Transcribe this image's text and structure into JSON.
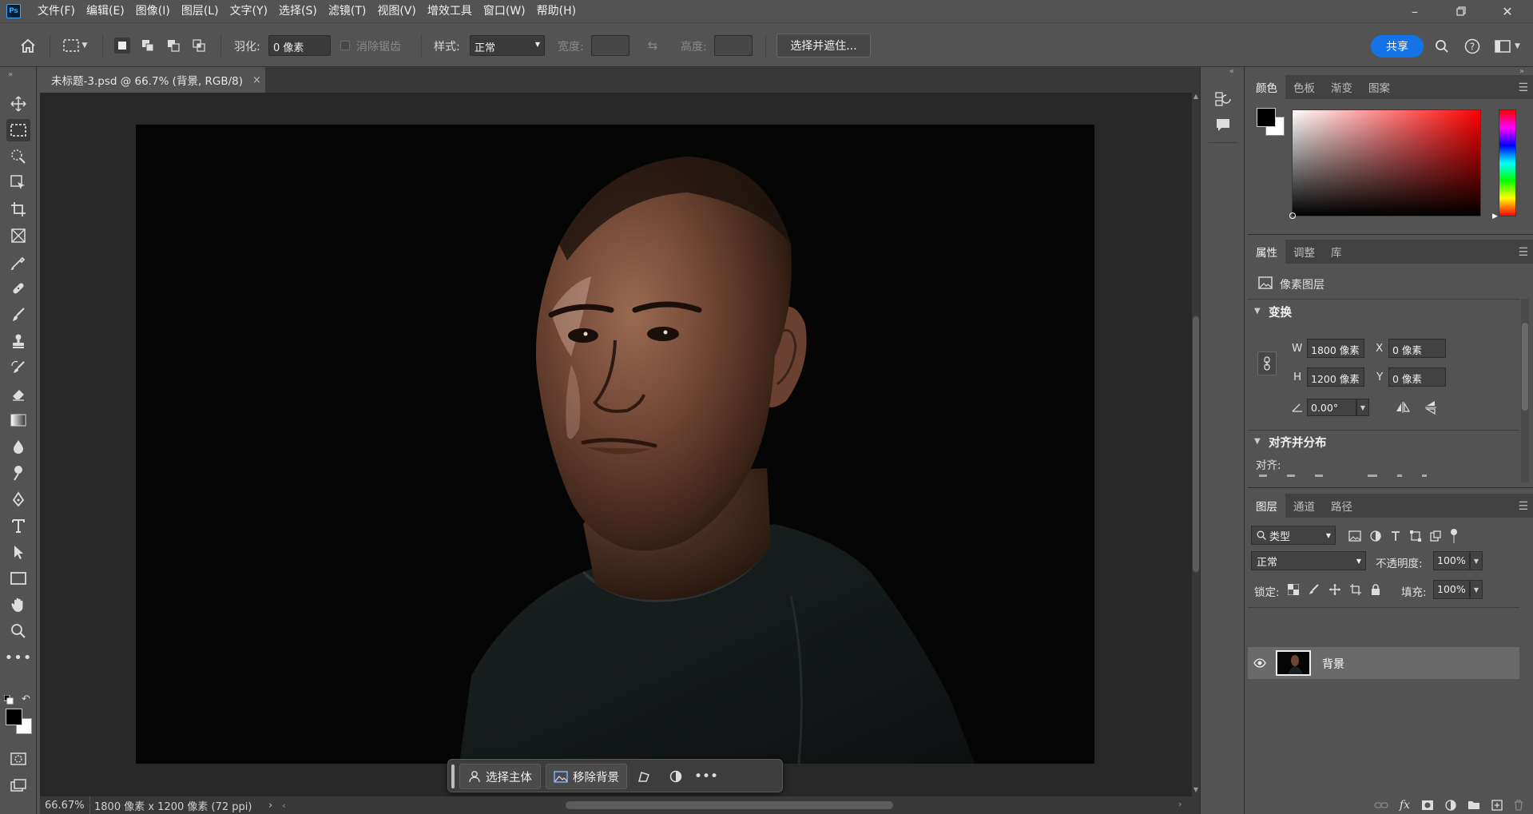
{
  "menubar": {
    "logo": "Ps",
    "items": [
      "文件(F)",
      "编辑(E)",
      "图像(I)",
      "图层(L)",
      "文字(Y)",
      "选择(S)",
      "滤镜(T)",
      "视图(V)",
      "增效工具",
      "窗口(W)",
      "帮助(H)"
    ]
  },
  "options": {
    "feather_label": "羽化:",
    "feather_value": "0 像素",
    "antialias_label": "消除锯齿",
    "style_label": "样式:",
    "style_value": "正常",
    "width_label": "宽度:",
    "height_label": "高度:",
    "select_mask_button": "选择并遮住...",
    "share_button": "共享"
  },
  "document": {
    "tab_title": "未标题-3.psd @ 66.7% (背景, RGB/8)",
    "close_glyph": "×"
  },
  "status": {
    "zoom": "66.67%",
    "doc_info": "1800 像素 x 1200 像素 (72 ppi)"
  },
  "contextual_taskbar": {
    "select_subject": "选择主体",
    "remove_background": "移除背景"
  },
  "color_panel": {
    "tabs": [
      "颜色",
      "色板",
      "渐变",
      "图案"
    ],
    "foreground": "#000000",
    "background": "#ffffff",
    "hue": "#ff0000"
  },
  "properties_panel": {
    "tabs": [
      "属性",
      "调整",
      "库"
    ],
    "layer_type": "像素图层",
    "transform_title": "变换",
    "w_label": "W",
    "w_value": "1800 像素",
    "h_label": "H",
    "h_value": "1200 像素",
    "x_label": "X",
    "x_value": "0 像素",
    "y_label": "Y",
    "y_value": "0 像素",
    "angle_value": "0.00°",
    "align_title": "对齐并分布",
    "align_label": "对齐:"
  },
  "layers_panel": {
    "tabs": [
      "图层",
      "通道",
      "路径"
    ],
    "filter_kind": "类型",
    "blend_mode": "正常",
    "opacity_label": "不透明度:",
    "opacity_value": "100%",
    "lock_label": "锁定:",
    "fill_label": "填充:",
    "fill_value": "100%",
    "layers": [
      {
        "name": "背景",
        "visible": true
      }
    ]
  }
}
